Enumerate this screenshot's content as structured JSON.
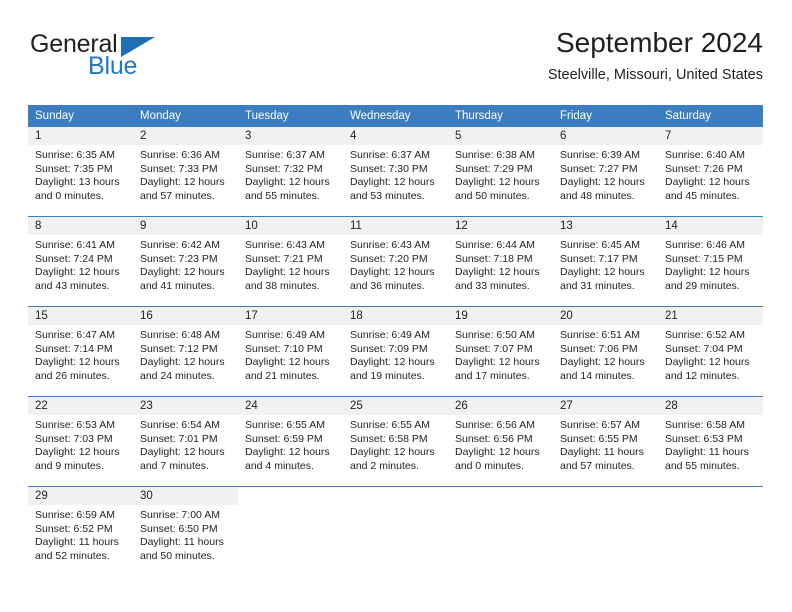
{
  "brand": {
    "name_part1": "General",
    "name_part2": "Blue",
    "triangle_color": "#1f6fb5",
    "blue_color": "#1f78c1"
  },
  "header": {
    "title": "September 2024",
    "subtitle": "Steelville, Missouri, United States"
  },
  "theme": {
    "header_blue": "#3b7dc0",
    "daynum_gray": "#f1f1f1",
    "text": "#231f20"
  },
  "calendar": {
    "weekday_headers": [
      "Sunday",
      "Monday",
      "Tuesday",
      "Wednesday",
      "Thursday",
      "Friday",
      "Saturday"
    ],
    "labels": {
      "sunrise": "Sunrise:",
      "sunset": "Sunset:",
      "daylight": "Daylight:"
    },
    "weeks": [
      [
        {
          "day": "1",
          "sunrise": "Sunrise: 6:35 AM",
          "sunset": "Sunset: 7:35 PM",
          "daylight1": "Daylight: 13 hours",
          "daylight2": "and 0 minutes."
        },
        {
          "day": "2",
          "sunrise": "Sunrise: 6:36 AM",
          "sunset": "Sunset: 7:33 PM",
          "daylight1": "Daylight: 12 hours",
          "daylight2": "and 57 minutes."
        },
        {
          "day": "3",
          "sunrise": "Sunrise: 6:37 AM",
          "sunset": "Sunset: 7:32 PM",
          "daylight1": "Daylight: 12 hours",
          "daylight2": "and 55 minutes."
        },
        {
          "day": "4",
          "sunrise": "Sunrise: 6:37 AM",
          "sunset": "Sunset: 7:30 PM",
          "daylight1": "Daylight: 12 hours",
          "daylight2": "and 53 minutes."
        },
        {
          "day": "5",
          "sunrise": "Sunrise: 6:38 AM",
          "sunset": "Sunset: 7:29 PM",
          "daylight1": "Daylight: 12 hours",
          "daylight2": "and 50 minutes."
        },
        {
          "day": "6",
          "sunrise": "Sunrise: 6:39 AM",
          "sunset": "Sunset: 7:27 PM",
          "daylight1": "Daylight: 12 hours",
          "daylight2": "and 48 minutes."
        },
        {
          "day": "7",
          "sunrise": "Sunrise: 6:40 AM",
          "sunset": "Sunset: 7:26 PM",
          "daylight1": "Daylight: 12 hours",
          "daylight2": "and 45 minutes."
        }
      ],
      [
        {
          "day": "8",
          "sunrise": "Sunrise: 6:41 AM",
          "sunset": "Sunset: 7:24 PM",
          "daylight1": "Daylight: 12 hours",
          "daylight2": "and 43 minutes."
        },
        {
          "day": "9",
          "sunrise": "Sunrise: 6:42 AM",
          "sunset": "Sunset: 7:23 PM",
          "daylight1": "Daylight: 12 hours",
          "daylight2": "and 41 minutes."
        },
        {
          "day": "10",
          "sunrise": "Sunrise: 6:43 AM",
          "sunset": "Sunset: 7:21 PM",
          "daylight1": "Daylight: 12 hours",
          "daylight2": "and 38 minutes."
        },
        {
          "day": "11",
          "sunrise": "Sunrise: 6:43 AM",
          "sunset": "Sunset: 7:20 PM",
          "daylight1": "Daylight: 12 hours",
          "daylight2": "and 36 minutes."
        },
        {
          "day": "12",
          "sunrise": "Sunrise: 6:44 AM",
          "sunset": "Sunset: 7:18 PM",
          "daylight1": "Daylight: 12 hours",
          "daylight2": "and 33 minutes."
        },
        {
          "day": "13",
          "sunrise": "Sunrise: 6:45 AM",
          "sunset": "Sunset: 7:17 PM",
          "daylight1": "Daylight: 12 hours",
          "daylight2": "and 31 minutes."
        },
        {
          "day": "14",
          "sunrise": "Sunrise: 6:46 AM",
          "sunset": "Sunset: 7:15 PM",
          "daylight1": "Daylight: 12 hours",
          "daylight2": "and 29 minutes."
        }
      ],
      [
        {
          "day": "15",
          "sunrise": "Sunrise: 6:47 AM",
          "sunset": "Sunset: 7:14 PM",
          "daylight1": "Daylight: 12 hours",
          "daylight2": "and 26 minutes."
        },
        {
          "day": "16",
          "sunrise": "Sunrise: 6:48 AM",
          "sunset": "Sunset: 7:12 PM",
          "daylight1": "Daylight: 12 hours",
          "daylight2": "and 24 minutes."
        },
        {
          "day": "17",
          "sunrise": "Sunrise: 6:49 AM",
          "sunset": "Sunset: 7:10 PM",
          "daylight1": "Daylight: 12 hours",
          "daylight2": "and 21 minutes."
        },
        {
          "day": "18",
          "sunrise": "Sunrise: 6:49 AM",
          "sunset": "Sunset: 7:09 PM",
          "daylight1": "Daylight: 12 hours",
          "daylight2": "and 19 minutes."
        },
        {
          "day": "19",
          "sunrise": "Sunrise: 6:50 AM",
          "sunset": "Sunset: 7:07 PM",
          "daylight1": "Daylight: 12 hours",
          "daylight2": "and 17 minutes."
        },
        {
          "day": "20",
          "sunrise": "Sunrise: 6:51 AM",
          "sunset": "Sunset: 7:06 PM",
          "daylight1": "Daylight: 12 hours",
          "daylight2": "and 14 minutes."
        },
        {
          "day": "21",
          "sunrise": "Sunrise: 6:52 AM",
          "sunset": "Sunset: 7:04 PM",
          "daylight1": "Daylight: 12 hours",
          "daylight2": "and 12 minutes."
        }
      ],
      [
        {
          "day": "22",
          "sunrise": "Sunrise: 6:53 AM",
          "sunset": "Sunset: 7:03 PM",
          "daylight1": "Daylight: 12 hours",
          "daylight2": "and 9 minutes."
        },
        {
          "day": "23",
          "sunrise": "Sunrise: 6:54 AM",
          "sunset": "Sunset: 7:01 PM",
          "daylight1": "Daylight: 12 hours",
          "daylight2": "and 7 minutes."
        },
        {
          "day": "24",
          "sunrise": "Sunrise: 6:55 AM",
          "sunset": "Sunset: 6:59 PM",
          "daylight1": "Daylight: 12 hours",
          "daylight2": "and 4 minutes."
        },
        {
          "day": "25",
          "sunrise": "Sunrise: 6:55 AM",
          "sunset": "Sunset: 6:58 PM",
          "daylight1": "Daylight: 12 hours",
          "daylight2": "and 2 minutes."
        },
        {
          "day": "26",
          "sunrise": "Sunrise: 6:56 AM",
          "sunset": "Sunset: 6:56 PM",
          "daylight1": "Daylight: 12 hours",
          "daylight2": "and 0 minutes."
        },
        {
          "day": "27",
          "sunrise": "Sunrise: 6:57 AM",
          "sunset": "Sunset: 6:55 PM",
          "daylight1": "Daylight: 11 hours",
          "daylight2": "and 57 minutes."
        },
        {
          "day": "28",
          "sunrise": "Sunrise: 6:58 AM",
          "sunset": "Sunset: 6:53 PM",
          "daylight1": "Daylight: 11 hours",
          "daylight2": "and 55 minutes."
        }
      ],
      [
        {
          "day": "29",
          "sunrise": "Sunrise: 6:59 AM",
          "sunset": "Sunset: 6:52 PM",
          "daylight1": "Daylight: 11 hours",
          "daylight2": "and 52 minutes."
        },
        {
          "day": "30",
          "sunrise": "Sunrise: 7:00 AM",
          "sunset": "Sunset: 6:50 PM",
          "daylight1": "Daylight: 11 hours",
          "daylight2": "and 50 minutes."
        },
        {
          "day": "",
          "sunrise": "",
          "sunset": "",
          "daylight1": "",
          "daylight2": ""
        },
        {
          "day": "",
          "sunrise": "",
          "sunset": "",
          "daylight1": "",
          "daylight2": ""
        },
        {
          "day": "",
          "sunrise": "",
          "sunset": "",
          "daylight1": "",
          "daylight2": ""
        },
        {
          "day": "",
          "sunrise": "",
          "sunset": "",
          "daylight1": "",
          "daylight2": ""
        },
        {
          "day": "",
          "sunrise": "",
          "sunset": "",
          "daylight1": "",
          "daylight2": ""
        }
      ]
    ]
  }
}
